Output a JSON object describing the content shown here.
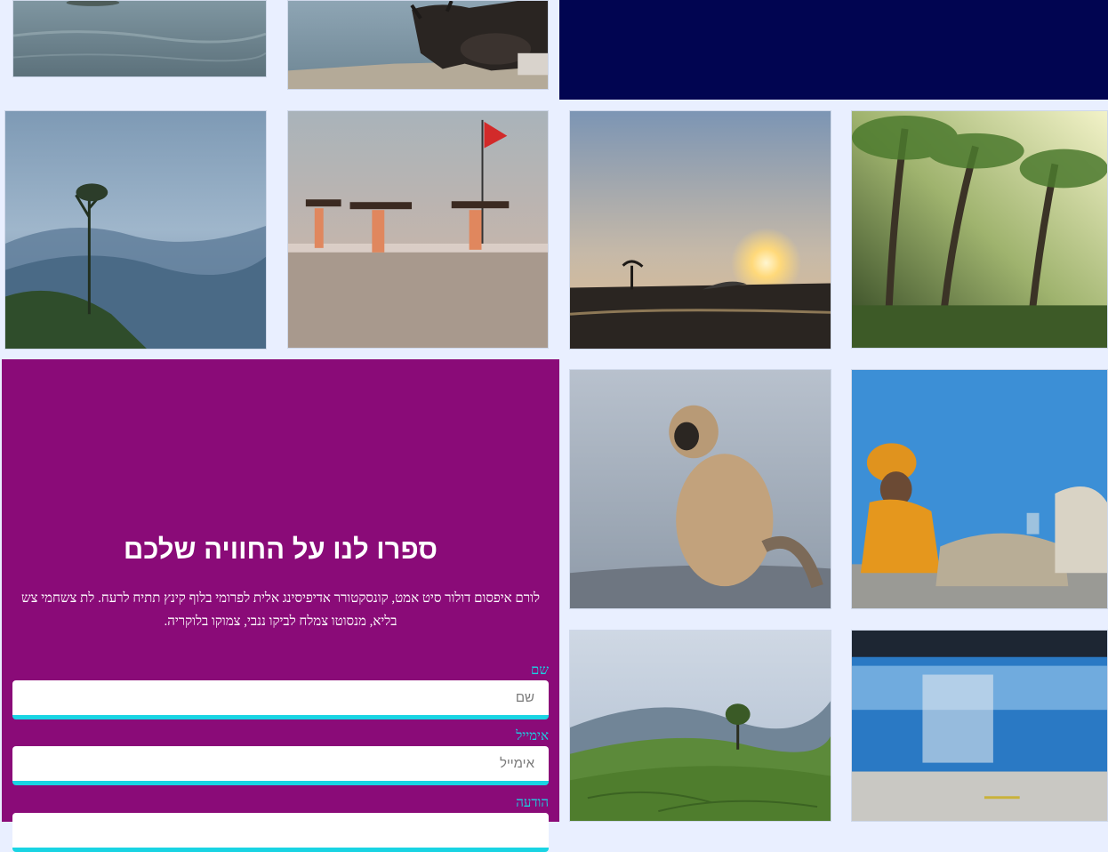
{
  "gallery": {
    "photos": [
      {
        "id": "beach-top",
        "icon": "photo-beach"
      },
      {
        "id": "cow-shore",
        "icon": "photo-cow"
      },
      {
        "id": "misty-hills",
        "icon": "photo-hills"
      },
      {
        "id": "women-beach-flag",
        "icon": "photo-beach-people"
      },
      {
        "id": "sunset",
        "icon": "photo-sunset"
      },
      {
        "id": "palm-forest",
        "icon": "photo-palms"
      },
      {
        "id": "monkey",
        "icon": "photo-monkey"
      },
      {
        "id": "sadhu",
        "icon": "photo-sadhu"
      },
      {
        "id": "tea-plantation",
        "icon": "photo-tea"
      },
      {
        "id": "train",
        "icon": "photo-train"
      }
    ]
  },
  "colors": {
    "navy_block": "#010551",
    "form_bg": "#8a0b78",
    "accent": "#19d4e3",
    "page_bg": "#e9efff"
  },
  "form": {
    "title": "ספרו לנו על החוויה שלכם",
    "description": "לורם איפסום דולור סיט אמט, קונסקטורר אדיפיסינג אלית לפרומי בלוף קינץ תתיח לרעח. לת צשחמי צש בליא, מנסוטו צמלח לביקו ננבי, צמוקו בלוקריה.",
    "fields": {
      "name": {
        "label": "שם",
        "placeholder": "שם",
        "value": ""
      },
      "email": {
        "label": "אימייל",
        "placeholder": "אימייל",
        "value": ""
      },
      "message": {
        "label": "הודעה",
        "placeholder": "",
        "value": ""
      }
    }
  }
}
